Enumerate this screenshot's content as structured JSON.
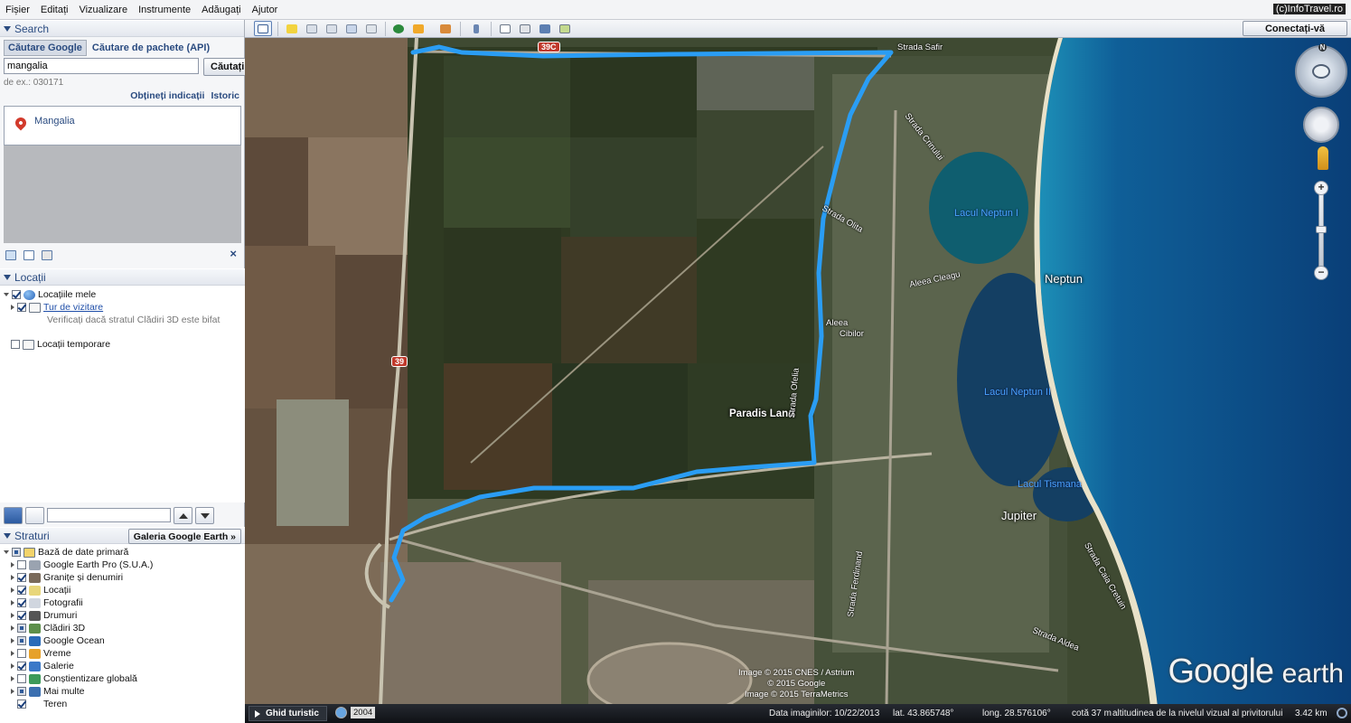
{
  "menu": [
    "Fișier",
    "Editați",
    "Vizualizare",
    "Instrumente",
    "Adăugați",
    "Ajutor"
  ],
  "watermark": "(c)InfoTravel.ro",
  "search": {
    "title": "Search",
    "tab_active": "Căutare Google",
    "tab_other": "Căutare de pachete (API)",
    "value": "mangalia",
    "button": "Căutați",
    "hint": "de ex.: 030171",
    "link_directions": "Obțineți indicații",
    "link_history": "Istoric",
    "result": "Mangalia"
  },
  "places": {
    "title": "Locații",
    "items": [
      {
        "label": "Locațiile mele"
      },
      {
        "label": "Tur de vizitare",
        "note": "Verificați dacă stratul Clădiri 3D este bifat"
      },
      {
        "label": "Locații temporare"
      }
    ]
  },
  "layers": {
    "title": "Straturi",
    "gallery_button": "Galeria Google Earth",
    "gallery_arrow": "»",
    "root": "Bază de date primară",
    "items": [
      {
        "label": "Google Earth Pro (S.U.A.)",
        "checked": "off",
        "icon": "ge-pro-icon"
      },
      {
        "label": "Granițe și denumiri",
        "checked": "on",
        "icon": "borders-flag-icon"
      },
      {
        "label": "Locații",
        "checked": "on",
        "icon": "places-icon"
      },
      {
        "label": "Fotografii",
        "checked": "on",
        "icon": "photos-icon"
      },
      {
        "label": "Drumuri",
        "checked": "on",
        "icon": "roads-icon"
      },
      {
        "label": "Clădiri 3D",
        "checked": "part",
        "icon": "buildings-3d-icon"
      },
      {
        "label": "Google Ocean",
        "checked": "part",
        "icon": "ocean-globe-icon"
      },
      {
        "label": "Vreme",
        "checked": "off",
        "icon": "weather-sun-icon"
      },
      {
        "label": "Galerie",
        "checked": "on",
        "icon": "gallery-star-icon"
      },
      {
        "label": "Conștientizare globală",
        "checked": "off",
        "icon": "global-awareness-icon"
      },
      {
        "label": "Mai multe",
        "checked": "part",
        "icon": "more-icon"
      },
      {
        "label": "Teren",
        "checked": "on",
        "icon": "terrain-icon"
      }
    ]
  },
  "toolbar": {
    "signin": "Conectați-vă",
    "icons": [
      "sidebar-toggle-icon",
      "placemark-icon",
      "polygon-icon",
      "path-icon",
      "image-overlay-icon",
      "record-tour-icon",
      "historical-imagery-icon",
      "sunlight-icon",
      "planets-icon",
      "ruler-icon",
      "email-icon",
      "print-icon",
      "save-image-icon",
      "view-in-maps-icon"
    ]
  },
  "map": {
    "labels": {
      "road_39c": "39C",
      "road_39": "39",
      "strada_safir": "Strada Safir",
      "strada_crinului": "Strada Crinului",
      "strada_olita": "Strada Olita",
      "aleea_cibi": "Aleea",
      "aleea_cibi2": "Cibilor",
      "aleea_ciucurul": "Aleea Cleagu",
      "lacul_neptun": "Lacul Neptun I",
      "lacul_neptun2": "Lacul Neptun II",
      "lacul_tismana": "Lacul Tismana",
      "neptun": "Neptun",
      "jupiter": "Jupiter",
      "paradis": "Paradis Land",
      "strada_ferdinand": "Strada Ferdinand",
      "strada_aldea": "Strada Aldea",
      "strada_ofelia": "Strada Ofelia",
      "strada_chiria": "Strada Caia Cretuin"
    },
    "credits": [
      "Image © 2015 CNES / Astrium",
      "© 2015 Google",
      "Image © 2015 TerraMetrics"
    ],
    "logo_main": "Google",
    "logo_sub": "earth",
    "compass_n": "N",
    "zoom_plus": "+",
    "zoom_minus": "−"
  },
  "status": {
    "tour_button": "Ghid turistic",
    "year": "2004",
    "date": "Data imaginilor: 10/22/2013",
    "lat": "lat.  43.865748°",
    "lon": "long.  28.576106°",
    "elev": "cotă   37 m",
    "eye": "altitudinea de la nivelul vizual al privitorului",
    "eye_val": "3.42 km"
  },
  "colors": {
    "route": "#2a9df4",
    "panel_head": "#2a4b80"
  }
}
